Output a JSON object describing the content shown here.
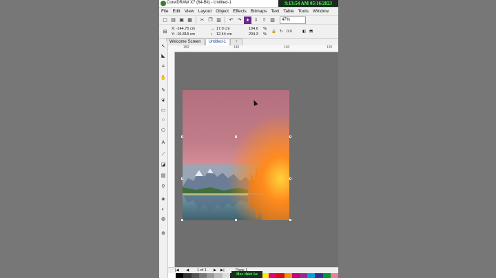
{
  "window": {
    "title": "CorelDRAW X7 (64-Bit) - Untitled-1"
  },
  "clock": "9:13:54 AM 05/16/2023",
  "menu": [
    "File",
    "Edit",
    "View",
    "Layout",
    "Object",
    "Effects",
    "Bitmaps",
    "Text",
    "Table",
    "Tools",
    "Window"
  ],
  "toolbar": {
    "zoom": "47%",
    "angle": "0.0"
  },
  "props": {
    "x": "X: -144.75 cm",
    "y": "Y: -16.818 cm",
    "w": "17.0 cm",
    "h": "12.44 cm",
    "sx": "104.6",
    "sy": "204.3",
    "pct": "%"
  },
  "tabs": [
    "Welcome Screen",
    "Untitled-1"
  ],
  "ruler": [
    "150",
    "140",
    "130",
    "120"
  ],
  "status": {
    "pages": "1 of 1",
    "page": "Page 1"
  },
  "watermark": "Hoc thiet ke",
  "colors": {
    "accent": "#1a3fa0",
    "clock_text": "#4cff4c"
  }
}
